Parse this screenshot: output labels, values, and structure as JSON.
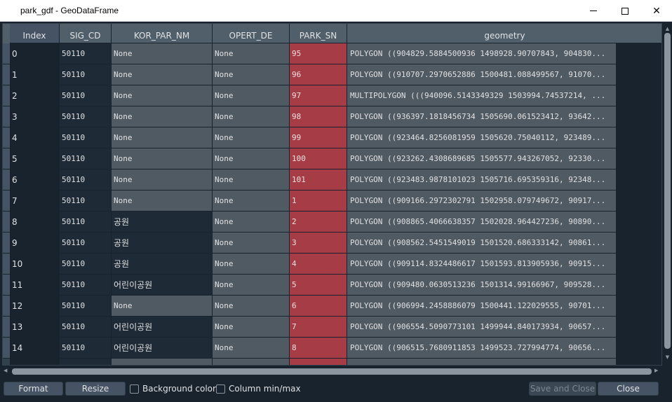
{
  "window": {
    "title": "park_gdf - GeoDataFrame",
    "minimize_glyph": "",
    "maximize_glyph": "",
    "close_glyph": "✕"
  },
  "table": {
    "columns": [
      "Index",
      "SIG_CD",
      "KOR_PAR_NM",
      "OPERT_DE",
      "PARK_SN",
      "geometry"
    ],
    "rows": [
      {
        "index": "0",
        "sig": "50110",
        "kor": "None",
        "opd": "None",
        "park": "95",
        "geom": "POLYGON ((904829.5884500936 1498928.90707843, 904830..."
      },
      {
        "index": "1",
        "sig": "50110",
        "kor": "None",
        "opd": "None",
        "park": "96",
        "geom": "POLYGON ((910707.2970652886 1500481.088499567, 91070..."
      },
      {
        "index": "2",
        "sig": "50110",
        "kor": "None",
        "opd": "None",
        "park": "97",
        "geom": "MULTIPOLYGON (((940096.5143349329 1503994.74537214, ..."
      },
      {
        "index": "3",
        "sig": "50110",
        "kor": "None",
        "opd": "None",
        "park": "98",
        "geom": "POLYGON ((936397.1818456734 1505690.061523412, 93642..."
      },
      {
        "index": "4",
        "sig": "50110",
        "kor": "None",
        "opd": "None",
        "park": "99",
        "geom": "POLYGON ((923464.8256081959 1505620.75040112, 923489..."
      },
      {
        "index": "5",
        "sig": "50110",
        "kor": "None",
        "opd": "None",
        "park": "100",
        "geom": "POLYGON ((923262.4308689685 1505577.943267052, 92330..."
      },
      {
        "index": "6",
        "sig": "50110",
        "kor": "None",
        "opd": "None",
        "park": "101",
        "geom": "POLYGON ((923483.9878101023 1505716.695359316, 92348..."
      },
      {
        "index": "7",
        "sig": "50110",
        "kor": "None",
        "opd": "None",
        "park": "1",
        "geom": "POLYGON ((909166.2972302791 1502958.079749672, 90917..."
      },
      {
        "index": "8",
        "sig": "50110",
        "kor": "공원",
        "opd": "None",
        "park": "2",
        "geom": "POLYGON ((908865.4066638357 1502028.964427236, 90890..."
      },
      {
        "index": "9",
        "sig": "50110",
        "kor": "공원",
        "opd": "None",
        "park": "3",
        "geom": "POLYGON ((908562.5451549019 1501520.686333142, 90861..."
      },
      {
        "index": "10",
        "sig": "50110",
        "kor": "공원",
        "opd": "None",
        "park": "4",
        "geom": "POLYGON ((909114.8324486617 1501593.813905936, 90915..."
      },
      {
        "index": "11",
        "sig": "50110",
        "kor": "어린이공원",
        "opd": "None",
        "park": "5",
        "geom": "POLYGON ((909480.0630513236 1501314.99166967, 909528..."
      },
      {
        "index": "12",
        "sig": "50110",
        "kor": "None",
        "opd": "None",
        "park": "6",
        "geom": "POLYGON ((906994.2458886079 1500441.122029555, 90701..."
      },
      {
        "index": "13",
        "sig": "50110",
        "kor": "어린이공원",
        "opd": "None",
        "park": "7",
        "geom": "POLYGON ((906554.5090773101 1499944.840173934, 90657..."
      },
      {
        "index": "14",
        "sig": "50110",
        "kor": "어린이공원",
        "opd": "None",
        "park": "8",
        "geom": "POLYGON ((906515.7680911853 1499523.727994774, 90656..."
      }
    ]
  },
  "controls": {
    "format_label": "Format",
    "resize_label": "Resize",
    "background_color_label": "Background color",
    "column_minmax_label": "Column min/max",
    "save_close_label": "Save and Close",
    "close_label": "Close"
  }
}
